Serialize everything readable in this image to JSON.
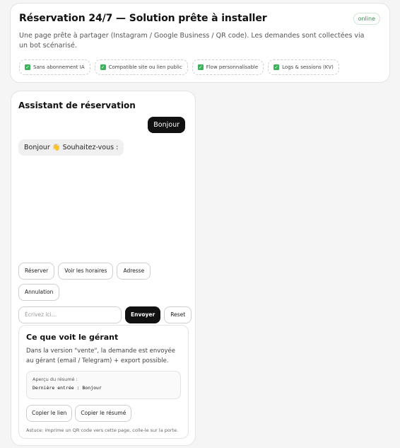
{
  "header": {
    "title": "Réservation 24/7 — Solution prête à installer",
    "status": "online",
    "description": "Une page prête à partager (Instagram / Google Business / QR code). Les demandes sont collectées via un bot scénarisé.",
    "chips": [
      {
        "label": "Sans abonnement IA",
        "icon": "check-icon"
      },
      {
        "label": "Compatible site ou lien public",
        "icon": "check-icon"
      },
      {
        "label": "Flow personnalisable",
        "icon": "check-icon"
      },
      {
        "label": "Logs & sessions (KV)",
        "icon": "check-icon"
      }
    ]
  },
  "chat": {
    "title": "Assistant de réservation",
    "messages": [
      {
        "from": "user",
        "text": "Bonjour"
      },
      {
        "from": "bot",
        "text": "Bonjour 👋 Souhaitez-vous :"
      }
    ],
    "quick_replies": [
      "Réserver",
      "Voir les horaires",
      "Adresse",
      "Annulation"
    ],
    "input_placeholder": "Écrivez ici…",
    "send_label": "Envoyer",
    "reset_label": "Reset"
  },
  "manager": {
    "title": "Ce que voit le gérant",
    "description": "Dans la version \"vente\", la demande est envoyée au gérant (email / Telegram) + export possible.",
    "summary_label": "Aperçu du résumé :",
    "summary_text": "Dernière entrée : Bonjour",
    "copy_link_label": "Copier le lien",
    "copy_summary_label": "Copier le résumé",
    "tip": "Astuce: imprime un QR code vers cette page, colle-le sur la porte."
  },
  "colors": {
    "accent": "#111111",
    "success": "#3cb35a",
    "background": "#f5f5f5"
  }
}
